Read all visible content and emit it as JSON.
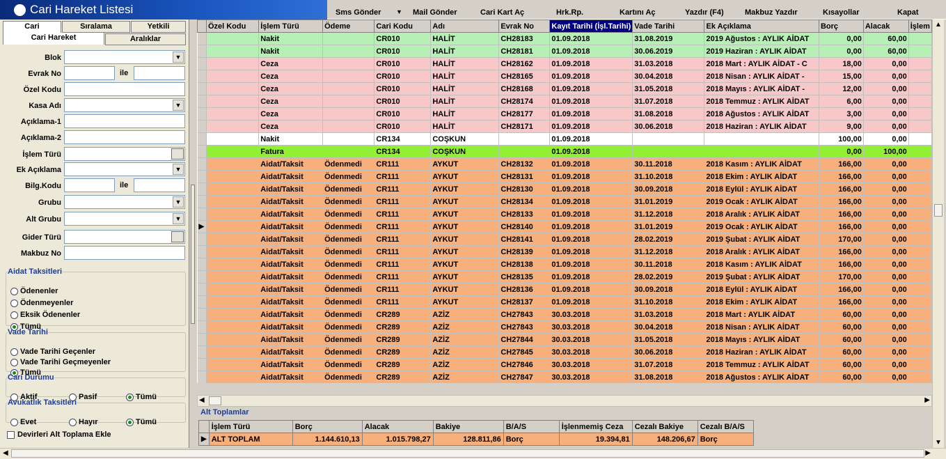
{
  "window": {
    "title": "Cari Hareket Listesi"
  },
  "menu": [
    "Sms Gönder",
    "Mail Gönder",
    "Cari Kart Aç",
    "Hrk.Rp.",
    "Kartını Aç",
    "Yazdır (F4)",
    "Makbuz Yazdır",
    "Kısayollar",
    "Kapat"
  ],
  "tabs_top": [
    "Cari",
    "Sıralama",
    "Yetkili"
  ],
  "tabs_second": [
    "Cari Hareket",
    "Aralıklar"
  ],
  "filters": {
    "blok": "Blok",
    "evrak_no": "Evrak No",
    "ile": "ile",
    "ozel_kodu": "Özel Kodu",
    "kasa_adi": "Kasa Adı",
    "aciklama1": "Açıklama-1",
    "aciklama2": "Açıklama-2",
    "islem_turu": "İşlem Türü",
    "ek_aciklama": "Ek Açıklama",
    "bilg_kodu": "Bilg.Kodu",
    "grubu": "Grubu",
    "alt_grubu": "Alt Grubu",
    "gider_turu": "Gider Türü",
    "makbuz_no": "Makbuz No"
  },
  "groups": {
    "aidat": {
      "title": "Aidat Taksitleri",
      "options": [
        "Ödenenler",
        "Ödenmeyenler",
        "Eksik Ödenenler",
        "Tümü"
      ]
    },
    "vade": {
      "title": "Vade Tarihi",
      "options": [
        "Vade Tarihi Geçenler",
        "Vade Tarihi Geçmeyenler",
        "Tümü"
      ]
    },
    "cari": {
      "title": "Cari Durumu",
      "options": [
        "Aktif",
        "Pasif",
        "Tümü"
      ]
    },
    "avukat": {
      "title": "Avukatlık Taksitleri",
      "options": [
        "Evet",
        "Hayır",
        "Tümü"
      ]
    }
  },
  "devir_checkbox": "Devirleri Alt Toplama Ekle",
  "grid": {
    "columns": [
      "Özel Kodu",
      "İşlem Türü",
      "Ödeme",
      "Cari Kodu",
      "Adı",
      "Evrak No",
      "Kayıt Tarihi (İşl.Tarihi)",
      "Vade Tarihi",
      "Ek Açıklama",
      "Borç",
      "Alacak",
      "İşlem"
    ],
    "rows": [
      {
        "c": "green",
        "v": [
          "",
          "Nakit",
          "",
          "CR010",
          "HALİT",
          "CH28183",
          "01.09.2018",
          "31.08.2019",
          "2019 Ağustos : AYLIK AİDAT",
          "0,00",
          "60,00"
        ]
      },
      {
        "c": "green",
        "v": [
          "",
          "Nakit",
          "",
          "CR010",
          "HALİT",
          "CH28181",
          "01.09.2018",
          "30.06.2019",
          "2019 Haziran : AYLIK AİDAT",
          "0,00",
          "60,00"
        ]
      },
      {
        "c": "red",
        "v": [
          "",
          "Ceza",
          "",
          "CR010",
          "HALİT",
          "CH28162",
          "01.09.2018",
          "31.03.2018",
          "2018 Mart : AYLIK AİDAT - C",
          "18,00",
          "0,00"
        ]
      },
      {
        "c": "red",
        "v": [
          "",
          "Ceza",
          "",
          "CR010",
          "HALİT",
          "CH28165",
          "01.09.2018",
          "30.04.2018",
          "2018 Nisan : AYLIK AİDAT -",
          "15,00",
          "0,00"
        ]
      },
      {
        "c": "red",
        "v": [
          "",
          "Ceza",
          "",
          "CR010",
          "HALİT",
          "CH28168",
          "01.09.2018",
          "31.05.2018",
          "2018 Mayıs : AYLIK AİDAT -",
          "12,00",
          "0,00"
        ]
      },
      {
        "c": "red",
        "v": [
          "",
          "Ceza",
          "",
          "CR010",
          "HALİT",
          "CH28174",
          "01.09.2018",
          "31.07.2018",
          "2018 Temmuz : AYLIK AİDAT",
          "6,00",
          "0,00"
        ]
      },
      {
        "c": "red",
        "v": [
          "",
          "Ceza",
          "",
          "CR010",
          "HALİT",
          "CH28177",
          "01.09.2018",
          "31.08.2018",
          "2018 Ağustos : AYLIK AİDAT",
          "3,00",
          "0,00"
        ]
      },
      {
        "c": "red",
        "v": [
          "",
          "Ceza",
          "",
          "CR010",
          "HALİT",
          "CH28171",
          "01.09.2018",
          "30.06.2018",
          "2018 Haziran : AYLIK AİDAT",
          "9,00",
          "0,00"
        ]
      },
      {
        "c": "white",
        "v": [
          "",
          "Nakit",
          "",
          "CR134",
          "COŞKUN",
          "",
          "01.09.2018",
          "",
          "",
          "100,00",
          "0,00"
        ]
      },
      {
        "c": "lime",
        "v": [
          "",
          "Fatura",
          "",
          "CR134",
          "COŞKUN",
          "",
          "01.09.2018",
          "",
          "",
          "0,00",
          "100,00"
        ]
      },
      {
        "c": "orange",
        "v": [
          "",
          "Aidat/Taksit",
          "Ödenmedi",
          "CR111",
          "AYKUT",
          "CH28132",
          "01.09.2018",
          "30.11.2018",
          "2018 Kasım : AYLIK AİDAT",
          "166,00",
          "0,00"
        ]
      },
      {
        "c": "orange",
        "v": [
          "",
          "Aidat/Taksit",
          "Ödenmedi",
          "CR111",
          "AYKUT",
          "CH28131",
          "01.09.2018",
          "31.10.2018",
          "2018 Ekim : AYLIK AİDAT",
          "166,00",
          "0,00"
        ]
      },
      {
        "c": "orange",
        "v": [
          "",
          "Aidat/Taksit",
          "Ödenmedi",
          "CR111",
          "AYKUT",
          "CH28130",
          "01.09.2018",
          "30.09.2018",
          "2018 Eylül : AYLIK AİDAT",
          "166,00",
          "0,00"
        ]
      },
      {
        "c": "orange",
        "v": [
          "",
          "Aidat/Taksit",
          "Ödenmedi",
          "CR111",
          "AYKUT",
          "CH28134",
          "01.09.2018",
          "31.01.2019",
          "2019 Ocak : AYLIK AİDAT",
          "166,00",
          "0,00"
        ]
      },
      {
        "c": "orange",
        "v": [
          "",
          "Aidat/Taksit",
          "Ödenmedi",
          "CR111",
          "AYKUT",
          "CH28133",
          "01.09.2018",
          "31.12.2018",
          "2018 Aralık : AYLIK AİDAT",
          "166,00",
          "0,00"
        ]
      },
      {
        "c": "orange",
        "v": [
          "",
          "Aidat/Taksit",
          "Ödenmedi",
          "CR111",
          "AYKUT",
          "CH28140",
          "01.09.2018",
          "31.01.2019",
          "2019 Ocak : AYLIK AİDAT",
          "166,00",
          "0,00"
        ]
      },
      {
        "c": "orange",
        "v": [
          "",
          "Aidat/Taksit",
          "Ödenmedi",
          "CR111",
          "AYKUT",
          "CH28141",
          "01.09.2018",
          "28.02.2019",
          "2019 Şubat : AYLIK AİDAT",
          "170,00",
          "0,00"
        ]
      },
      {
        "c": "orange",
        "v": [
          "",
          "Aidat/Taksit",
          "Ödenmedi",
          "CR111",
          "AYKUT",
          "CH28139",
          "01.09.2018",
          "31.12.2018",
          "2018 Aralık : AYLIK AİDAT",
          "166,00",
          "0,00"
        ]
      },
      {
        "c": "orange",
        "v": [
          "",
          "Aidat/Taksit",
          "Ödenmedi",
          "CR111",
          "AYKUT",
          "CH28138",
          "01.09.2018",
          "30.11.2018",
          "2018 Kasım : AYLIK AİDAT",
          "166,00",
          "0,00"
        ]
      },
      {
        "c": "orange",
        "v": [
          "",
          "Aidat/Taksit",
          "Ödenmedi",
          "CR111",
          "AYKUT",
          "CH28135",
          "01.09.2018",
          "28.02.2019",
          "2019 Şubat : AYLIK AİDAT",
          "170,00",
          "0,00"
        ]
      },
      {
        "c": "orange",
        "v": [
          "",
          "Aidat/Taksit",
          "Ödenmedi",
          "CR111",
          "AYKUT",
          "CH28136",
          "01.09.2018",
          "30.09.2018",
          "2018 Eylül : AYLIK AİDAT",
          "166,00",
          "0,00"
        ]
      },
      {
        "c": "orange",
        "v": [
          "",
          "Aidat/Taksit",
          "Ödenmedi",
          "CR111",
          "AYKUT",
          "CH28137",
          "01.09.2018",
          "31.10.2018",
          "2018 Ekim : AYLIK AİDAT",
          "166,00",
          "0,00"
        ]
      },
      {
        "c": "orange",
        "v": [
          "",
          "Aidat/Taksit",
          "Ödenmedi",
          "CR289",
          "AZİZ",
          "CH27843",
          "30.03.2018",
          "31.03.2018",
          "2018 Mart : AYLIK AİDAT",
          "60,00",
          "0,00"
        ]
      },
      {
        "c": "orange",
        "v": [
          "",
          "Aidat/Taksit",
          "Ödenmedi",
          "CR289",
          "AZİZ",
          "CH27843",
          "30.03.2018",
          "30.04.2018",
          "2018 Nisan : AYLIK AİDAT",
          "60,00",
          "0,00"
        ]
      },
      {
        "c": "orange",
        "v": [
          "",
          "Aidat/Taksit",
          "Ödenmedi",
          "CR289",
          "AZİZ",
          "CH27844",
          "30.03.2018",
          "31.05.2018",
          "2018 Mayıs : AYLIK AİDAT",
          "60,00",
          "0,00"
        ]
      },
      {
        "c": "orange",
        "v": [
          "",
          "Aidat/Taksit",
          "Ödenmedi",
          "CR289",
          "AZİZ",
          "CH27845",
          "30.03.2018",
          "30.06.2018",
          "2018 Haziran : AYLIK AİDAT",
          "60,00",
          "0,00"
        ]
      },
      {
        "c": "orange",
        "v": [
          "",
          "Aidat/Taksit",
          "Ödenmedi",
          "CR289",
          "AZİZ",
          "CH27846",
          "30.03.2018",
          "31.07.2018",
          "2018 Temmuz : AYLIK AİDAT",
          "60,00",
          "0,00"
        ]
      },
      {
        "c": "orange",
        "v": [
          "",
          "Aidat/Taksit",
          "Ödenmedi",
          "CR289",
          "AZİZ",
          "CH27847",
          "30.03.2018",
          "31.08.2018",
          "2018 Ağustos : AYLIK AİDAT",
          "60,00",
          "0,00"
        ]
      }
    ]
  },
  "alt_toplamlar": {
    "title": "Alt Toplamlar",
    "columns": [
      "İşlem Türü",
      "Borç",
      "Alacak",
      "Bakiye",
      "B/A/S",
      "İşlenmemiş Ceza",
      "Cezalı Bakiye",
      "Cezalı B/A/S"
    ],
    "row": [
      "ALT TOPLAM",
      "1.144.610,13",
      "1.015.798,27",
      "128.811,86",
      "Borç",
      "19.394,81",
      "148.206,67",
      "Borç"
    ]
  }
}
